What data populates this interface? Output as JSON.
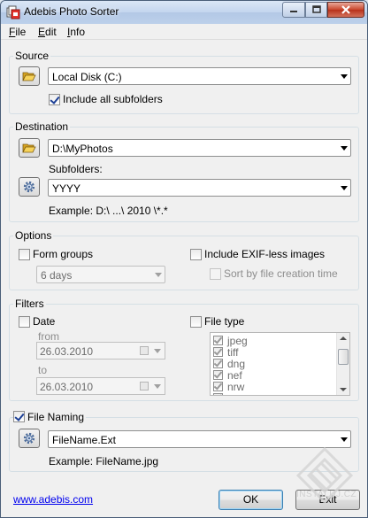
{
  "window": {
    "title": "Adebis Photo Sorter"
  },
  "menu": {
    "file": {
      "accel": "F",
      "rest": "ile"
    },
    "edit": {
      "accel": "E",
      "rest": "dit"
    },
    "info": {
      "accel": "I",
      "rest": "nfo"
    }
  },
  "source": {
    "legend": "Source",
    "drive_value": "Local Disk (C:)",
    "include_subfolders_label": "Include all subfolders",
    "include_subfolders_checked": true
  },
  "destination": {
    "legend": "Destination",
    "path_value": "D:\\MyPhotos",
    "subfolders_label": "Subfolders:",
    "subfolders_value": "YYYY",
    "example": "Example: D:\\ ...\\ 2010 \\*.*"
  },
  "options": {
    "legend": "Options",
    "form_groups_label": "Form groups",
    "form_groups_checked": false,
    "group_interval_value": "6 days",
    "include_exifless_label": "Include EXIF-less images",
    "include_exifless_checked": false,
    "sort_by_creation_label": "Sort by file creation time",
    "sort_by_creation_checked": false
  },
  "filters": {
    "legend": "Filters",
    "date_label": "Date",
    "date_checked": false,
    "from_label": "from",
    "from_value": "26.03.2010",
    "to_label": "to",
    "to_value": "26.03.2010",
    "file_type_label": "File type",
    "file_type_checked": false,
    "file_types": [
      "jpeg",
      "tiff",
      "dng",
      "nef",
      "nrw",
      "..."
    ]
  },
  "file_naming": {
    "legend": "File Naming",
    "checked": true,
    "pattern_value": "FileName.Ext",
    "example": "Example: FileName.jpg"
  },
  "footer": {
    "website": "www.adebis.com",
    "ok": "OK",
    "exit": "Exit"
  },
  "watermark": "INSTALUJ.CZ",
  "colors": {
    "accent": "#1c3f95",
    "link": "#0000ee",
    "close_button": "#c9462c"
  }
}
